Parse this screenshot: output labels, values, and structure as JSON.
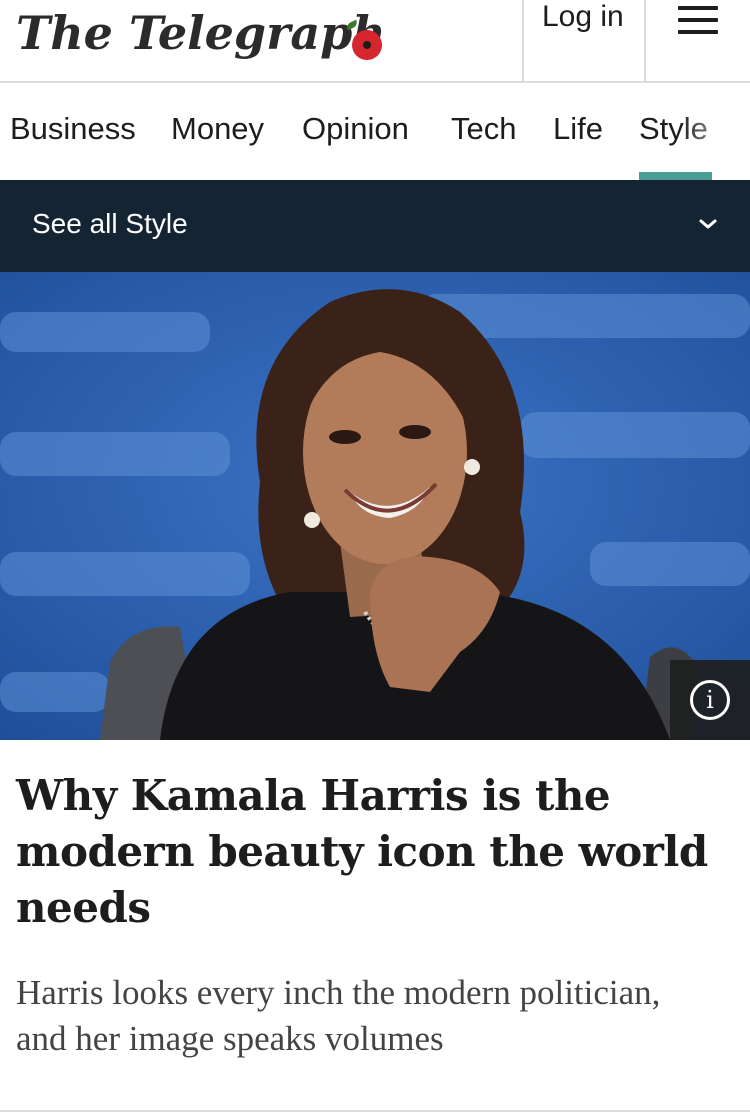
{
  "masthead": {
    "logo": "The Telegraph",
    "login_label": "Log in",
    "menu_icon": "hamburger-icon"
  },
  "section_nav": {
    "items": [
      {
        "label": "Business"
      },
      {
        "label": "Money"
      },
      {
        "label": "Opinion"
      },
      {
        "label": "Tech"
      },
      {
        "label": "Life"
      },
      {
        "label": "Style",
        "active": true
      }
    ],
    "active_color": "#4a9e95"
  },
  "see_all": {
    "label": "See all Style",
    "icon": "chevron-down-icon",
    "background": "#142433"
  },
  "hero": {
    "info_icon": "info-icon",
    "info_glyph": "i"
  },
  "article": {
    "headline": "Why Kamala Harris is the modern beauty icon the world needs",
    "standfirst": "Harris looks every inch the modern politician, and her image speaks volumes"
  }
}
